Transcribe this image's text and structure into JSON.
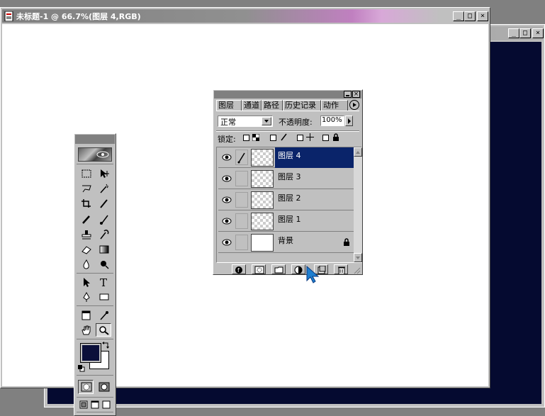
{
  "document": {
    "title": "未标题-1 @ 66.7%(图层 4,RGB)"
  },
  "window_controls": {
    "minimize": "_",
    "maximize": "□",
    "close": "×"
  },
  "layers_panel": {
    "tabs": [
      {
        "label": "图层"
      },
      {
        "label": "通道"
      },
      {
        "label": "路径"
      },
      {
        "label": "历史记录"
      },
      {
        "label": "动作"
      }
    ],
    "blend_mode": "正常",
    "opacity_label": "不透明度:",
    "opacity_value": "100%",
    "lock_label": "锁定:",
    "layers": [
      {
        "name": "图层 4",
        "selected": true,
        "thumb": "transparent"
      },
      {
        "name": "图层 3",
        "selected": false,
        "thumb": "transparent"
      },
      {
        "name": "图层 2",
        "selected": false,
        "thumb": "transparent"
      },
      {
        "name": "图层 1",
        "selected": false,
        "thumb": "transparent"
      },
      {
        "name": "背景",
        "selected": false,
        "thumb": "white",
        "locked": true
      }
    ]
  },
  "colors": {
    "foreground": "#0b0f3a",
    "background": "#ffffff",
    "selection": "#0a246a",
    "second_doc": "#050a30"
  }
}
